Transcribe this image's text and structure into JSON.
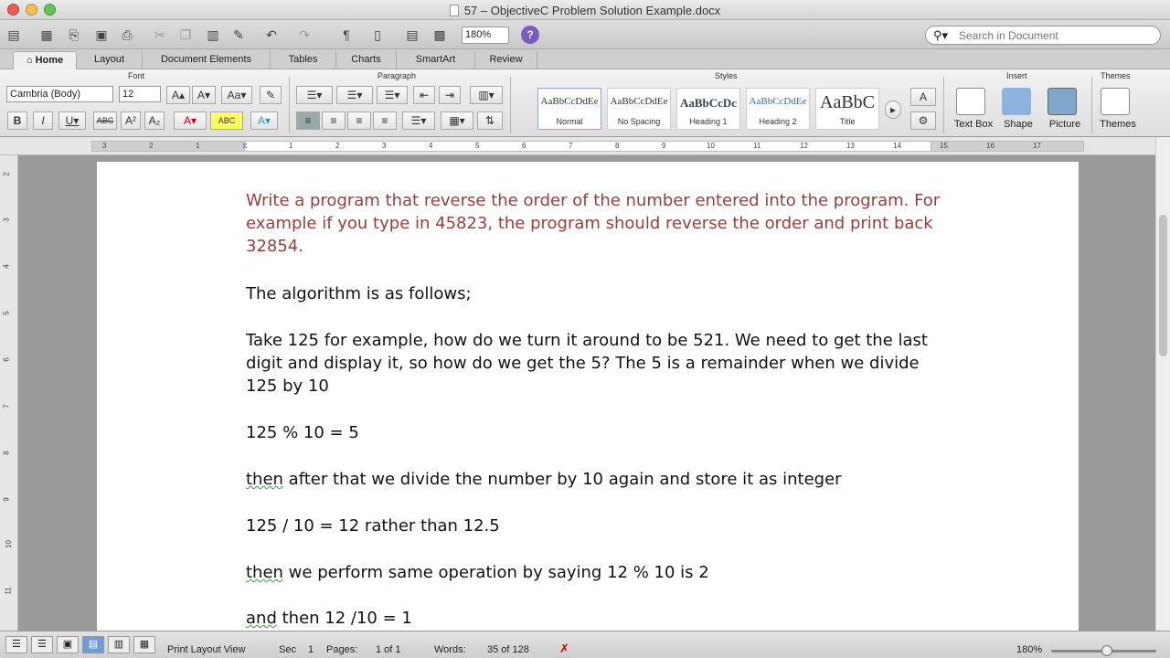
{
  "window": {
    "title": "57 – ObjectiveC Problem Solution Example.docx"
  },
  "toolbar": {
    "zoom": "180%",
    "search_placeholder": "Search in Document"
  },
  "tabs": [
    "Home",
    "Layout",
    "Document Elements",
    "Tables",
    "Charts",
    "SmartArt",
    "Review"
  ],
  "ribbon": {
    "groups": {
      "font": "Font",
      "paragraph": "Paragraph",
      "styles": "Styles",
      "insert": "Insert",
      "themes": "Themes"
    },
    "font_name": "Cambria (Body)",
    "font_size": "12",
    "styles": [
      {
        "sample": "AaBbCcDdEe",
        "label": "Normal"
      },
      {
        "sample": "AaBbCcDdEe",
        "label": "No Spacing"
      },
      {
        "sample": "AaBbCcDc",
        "label": "Heading 1"
      },
      {
        "sample": "AaBbCcDdEe",
        "label": "Heading 2"
      },
      {
        "sample": "AaBbC",
        "label": "Title"
      }
    ],
    "insert": [
      "Text Box",
      "Shape",
      "Picture"
    ],
    "themes_label": "Themes"
  },
  "document": {
    "p1": "Write a program that reverse the order of the number entered into the program. For example if you type in 45823, the program should reverse the order and print back 32854.",
    "p2": "The algorithm is as follows;",
    "p3": "Take 125 for example, how do we turn it around to be 521. We need to get the last digit and display it, so how do we get the 5? The 5 is a remainder when we divide 125 by 10",
    "p4": "125 % 10 = 5",
    "p5a": "then",
    "p5b": " after that we divide the number by 10 again and store it as integer",
    "p6": "125 / 10 = 12 rather than 12.5",
    "p7a": "then",
    "p7b": " we perform same operation by saying 12 % 10 is 2",
    "p8a": "and",
    "p8b": " then 12 /10  = 1"
  },
  "status": {
    "view": "Print Layout View",
    "sec_label": "Sec",
    "sec": "1",
    "pages_label": "Pages:",
    "pages": "1 of 1",
    "words_label": "Words:",
    "words": "35 of 128",
    "zoom": "180%"
  },
  "colors": {
    "prompt_text": "#9c3b3b",
    "help": "#7b5bbf"
  }
}
